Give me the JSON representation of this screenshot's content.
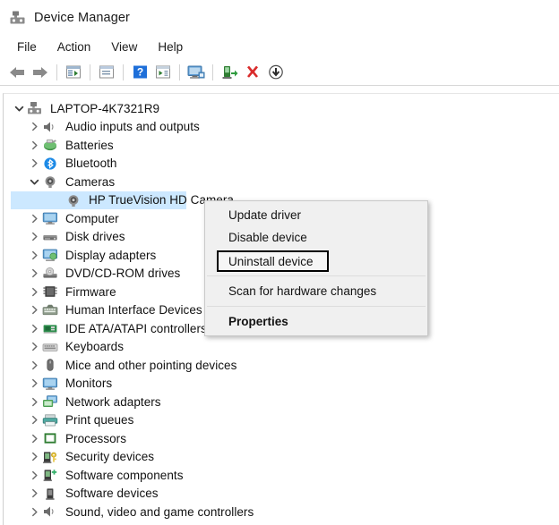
{
  "window": {
    "title": "Device Manager",
    "title_icon": "device-manager-icon"
  },
  "menubar": {
    "items": [
      {
        "label": "File",
        "name": "menu-file"
      },
      {
        "label": "Action",
        "name": "menu-action"
      },
      {
        "label": "View",
        "name": "menu-view"
      },
      {
        "label": "Help",
        "name": "menu-help"
      }
    ]
  },
  "toolbar": {
    "buttons": [
      {
        "icon": "back-arrow-icon",
        "tip": "Back"
      },
      {
        "icon": "forward-arrow-icon",
        "tip": "Forward"
      },
      {
        "icon": "show-hide-console-tree-icon",
        "tip": "Show/Hide console tree"
      },
      {
        "icon": "properties-icon",
        "tip": "Properties"
      },
      {
        "icon": "help-icon",
        "tip": "Help"
      },
      {
        "icon": "update-driver-icon",
        "tip": "Update driver"
      },
      {
        "icon": "scan-hardware-changes-icon",
        "tip": "Scan for hardware changes"
      },
      {
        "icon": "enable-device-icon",
        "tip": "Enable device"
      },
      {
        "icon": "uninstall-device-icon",
        "tip": "Uninstall device"
      },
      {
        "icon": "disable-device-icon",
        "tip": "Disable device"
      }
    ]
  },
  "tree": {
    "nodes": [
      {
        "label": "LAPTOP-4K7321R9",
        "level": 0,
        "state": "expanded",
        "icon": "computer-root-icon",
        "selected": false
      },
      {
        "label": "Audio inputs and outputs",
        "level": 1,
        "state": "collapsed",
        "icon": "speaker-icon",
        "selected": false
      },
      {
        "label": "Batteries",
        "level": 1,
        "state": "collapsed",
        "icon": "battery-icon",
        "selected": false
      },
      {
        "label": "Bluetooth",
        "level": 1,
        "state": "collapsed",
        "icon": "bluetooth-icon",
        "selected": false
      },
      {
        "label": "Cameras",
        "level": 1,
        "state": "expanded",
        "icon": "camera-icon",
        "selected": false
      },
      {
        "label": "HP TrueVision HD Camera",
        "level": 2,
        "state": "leaf",
        "icon": "camera-device-icon",
        "selected": true
      },
      {
        "label": "Computer",
        "level": 1,
        "state": "collapsed",
        "icon": "monitor-icon",
        "selected": false
      },
      {
        "label": "Disk drives",
        "level": 1,
        "state": "collapsed",
        "icon": "disk-drive-icon",
        "selected": false
      },
      {
        "label": "Display adapters",
        "level": 1,
        "state": "collapsed",
        "icon": "display-adapter-icon",
        "selected": false
      },
      {
        "label": "DVD/CD-ROM drives",
        "level": 1,
        "state": "collapsed",
        "icon": "optical-drive-icon",
        "selected": false
      },
      {
        "label": "Firmware",
        "level": 1,
        "state": "collapsed",
        "icon": "firmware-chip-icon",
        "selected": false
      },
      {
        "label": "Human Interface Devices",
        "level": 1,
        "state": "collapsed",
        "icon": "hid-icon",
        "selected": false
      },
      {
        "label": "IDE ATA/ATAPI controllers",
        "level": 1,
        "state": "collapsed",
        "icon": "ide-controller-icon",
        "selected": false
      },
      {
        "label": "Keyboards",
        "level": 1,
        "state": "collapsed",
        "icon": "keyboard-icon",
        "selected": false
      },
      {
        "label": "Mice and other pointing devices",
        "level": 1,
        "state": "collapsed",
        "icon": "mouse-icon",
        "selected": false
      },
      {
        "label": "Monitors",
        "level": 1,
        "state": "collapsed",
        "icon": "monitor-icon",
        "selected": false
      },
      {
        "label": "Network adapters",
        "level": 1,
        "state": "collapsed",
        "icon": "network-adapter-icon",
        "selected": false
      },
      {
        "label": "Print queues",
        "level": 1,
        "state": "collapsed",
        "icon": "printer-icon",
        "selected": false
      },
      {
        "label": "Processors",
        "level": 1,
        "state": "collapsed",
        "icon": "processor-icon",
        "selected": false
      },
      {
        "label": "Security devices",
        "level": 1,
        "state": "collapsed",
        "icon": "security-device-icon",
        "selected": false
      },
      {
        "label": "Software components",
        "level": 1,
        "state": "collapsed",
        "icon": "software-component-icon",
        "selected": false
      },
      {
        "label": "Software devices",
        "level": 1,
        "state": "collapsed",
        "icon": "software-device-icon",
        "selected": false
      },
      {
        "label": "Sound, video and game controllers",
        "level": 1,
        "state": "collapsed",
        "icon": "speaker-icon",
        "selected": false
      }
    ]
  },
  "context_menu": {
    "visible": true,
    "items": [
      {
        "label": "Update driver",
        "name": "ctx-update-driver",
        "bold": false,
        "boxed": false,
        "sep_after": false
      },
      {
        "label": "Disable device",
        "name": "ctx-disable-device",
        "bold": false,
        "boxed": false,
        "sep_after": false
      },
      {
        "label": "Uninstall device",
        "name": "ctx-uninstall-device",
        "bold": false,
        "boxed": true,
        "sep_after": true
      },
      {
        "label": "Scan for hardware changes",
        "name": "ctx-scan-hardware",
        "bold": false,
        "boxed": false,
        "sep_after": true
      },
      {
        "label": "Properties",
        "name": "ctx-properties",
        "bold": true,
        "boxed": false,
        "sep_after": false
      }
    ]
  },
  "colors": {
    "selection": "#cce8ff",
    "menu_background": "#f0f0f0",
    "highlight_border": "#000000",
    "toolbar_red": "#d92b2b",
    "toolbar_blue": "#1e6fd9",
    "toolbar_green": "#2e9b3e"
  }
}
